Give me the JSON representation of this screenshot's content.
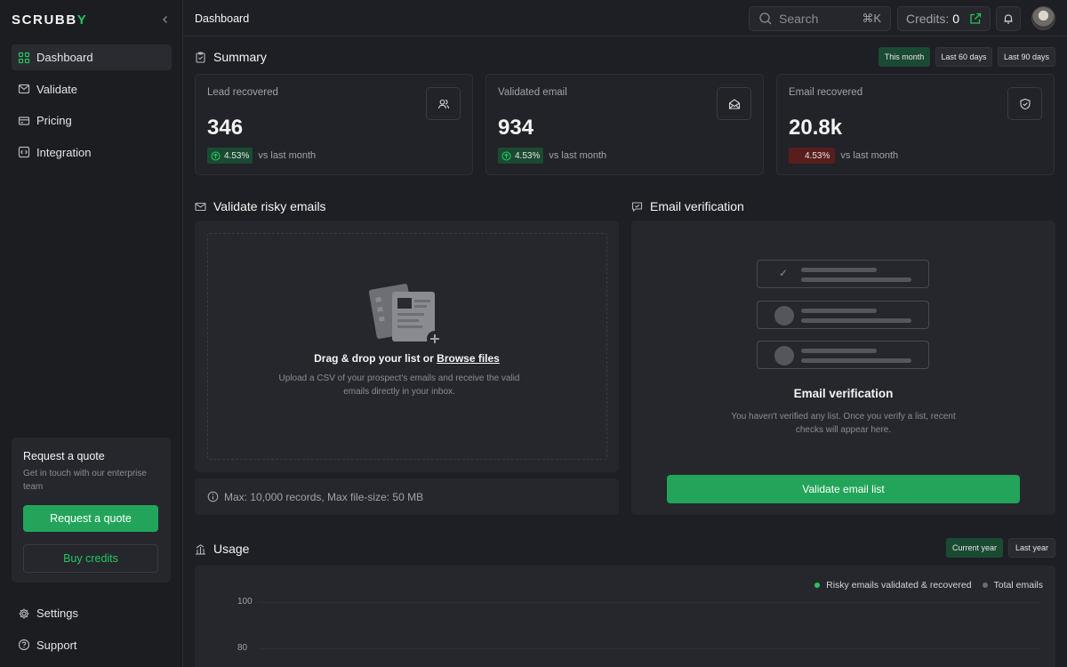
{
  "brand": {
    "name": "SCRUBB",
    "accent_letter": "Y",
    "accent_color": "#22c55e"
  },
  "sidebar": {
    "items": [
      {
        "label": "Dashboard",
        "icon": "grid-icon",
        "active": true
      },
      {
        "label": "Validate",
        "icon": "mail-icon"
      },
      {
        "label": "Pricing",
        "icon": "credit-card-icon"
      },
      {
        "label": "Integration",
        "icon": "code-icon"
      }
    ],
    "quote": {
      "title": "Request a quote",
      "subtitle": "Get in touch with our enterprise team",
      "primary": "Request a quote",
      "secondary": "Buy credits"
    },
    "bottom": [
      {
        "label": "Settings",
        "icon": "gear-icon"
      },
      {
        "label": "Support",
        "icon": "help-circle-icon"
      }
    ]
  },
  "topbar": {
    "breadcrumb": "Dashboard",
    "search_placeholder": "Search",
    "search_shortcut": "⌘K",
    "credits_label": "Credits:",
    "credits_value": "0"
  },
  "summary": {
    "title": "Summary",
    "ranges": [
      "This month",
      "Last 60 days",
      "Last 90 days"
    ],
    "selected_range": "This month",
    "cards": [
      {
        "label": "Lead recovered",
        "value": "346",
        "delta": "4.53%",
        "trend": "up",
        "compare": "vs last month",
        "icon": "users-icon"
      },
      {
        "label": "Validated email",
        "value": "934",
        "delta": "4.53%",
        "trend": "up",
        "compare": "vs last month",
        "icon": "envelope-open-icon"
      },
      {
        "label": "Email recovered",
        "value": "20.8k",
        "delta": "4.53%",
        "trend": "down",
        "compare": "vs last month",
        "icon": "shield-check-icon"
      }
    ]
  },
  "upload": {
    "title": "Validate risky emails",
    "main_text": "Drag & drop your list or",
    "link_text": "Browse files",
    "sub_text": "Upload a CSV of your prospect's emails and receive the valid emails directly in your inbox.",
    "limits": "Max: 10,000 records, Max file-size: 50 MB"
  },
  "verification": {
    "title": "Email verification",
    "heading": "Email verification",
    "sub_text": "You haven't verified any list. Once you verify a list, recent checks will appear here.",
    "button": "Validate email list"
  },
  "usage": {
    "title": "Usage",
    "ranges": [
      "Current year",
      "Last year"
    ],
    "selected_range": "Current year",
    "legend": [
      {
        "label": "Risky emails validated & recovered",
        "color": "#22c55e"
      },
      {
        "label": "Total emails",
        "color": "#6b6c72"
      }
    ],
    "y_ticks": [
      "100",
      "80"
    ]
  }
}
